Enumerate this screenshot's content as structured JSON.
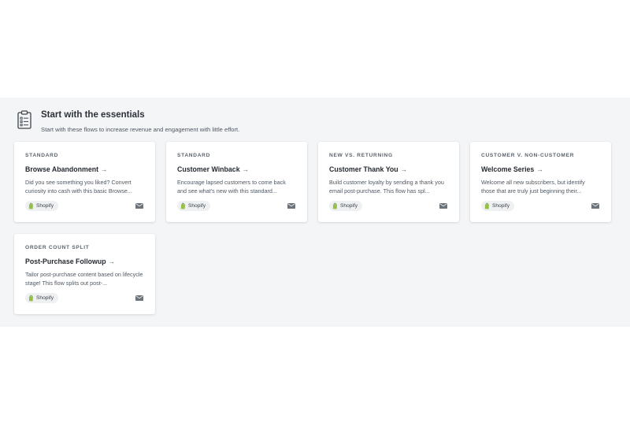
{
  "section": {
    "title": "Start with the essentials",
    "subtitle": "Start with these flows to increase revenue and engagement with little effort.",
    "icon": "clipboard-icon"
  },
  "colors": {
    "section_bg": "#f4f5f7",
    "card_bg": "#ffffff",
    "shopify_green": "#95bf47"
  },
  "cards": [
    {
      "category": "STANDARD",
      "title": "Browse Abandonment",
      "desc": "Did you see something you liked? Convert curiosity into cash with this basic Browse...",
      "badge": "Shopify",
      "channel_icon": "email-icon"
    },
    {
      "category": "STANDARD",
      "title": "Customer Winback",
      "desc": "Encourage lapsed customers to come back and see what's new with this standard...",
      "badge": "Shopify",
      "channel_icon": "email-icon"
    },
    {
      "category": "NEW VS. RETURNING",
      "title": "Customer Thank You",
      "desc": "Build customer loyalty by sending a thank you email post-purchase. This flow has spl...",
      "badge": "Shopify",
      "channel_icon": "email-icon"
    },
    {
      "category": "CUSTOMER V. NON-CUSTOMER",
      "title": "Welcome Series",
      "desc": "Welcome all new subscribers, but identify those that are truly just beginning their...",
      "badge": "Shopify",
      "channel_icon": "email-icon"
    },
    {
      "category": "ORDER COUNT SPLIT",
      "title": "Post-Purchase Followup",
      "desc": "Tailor post-purchase content based on lifecycle stage! This flow splits out post-...",
      "badge": "Shopify",
      "channel_icon": "email-icon"
    }
  ]
}
